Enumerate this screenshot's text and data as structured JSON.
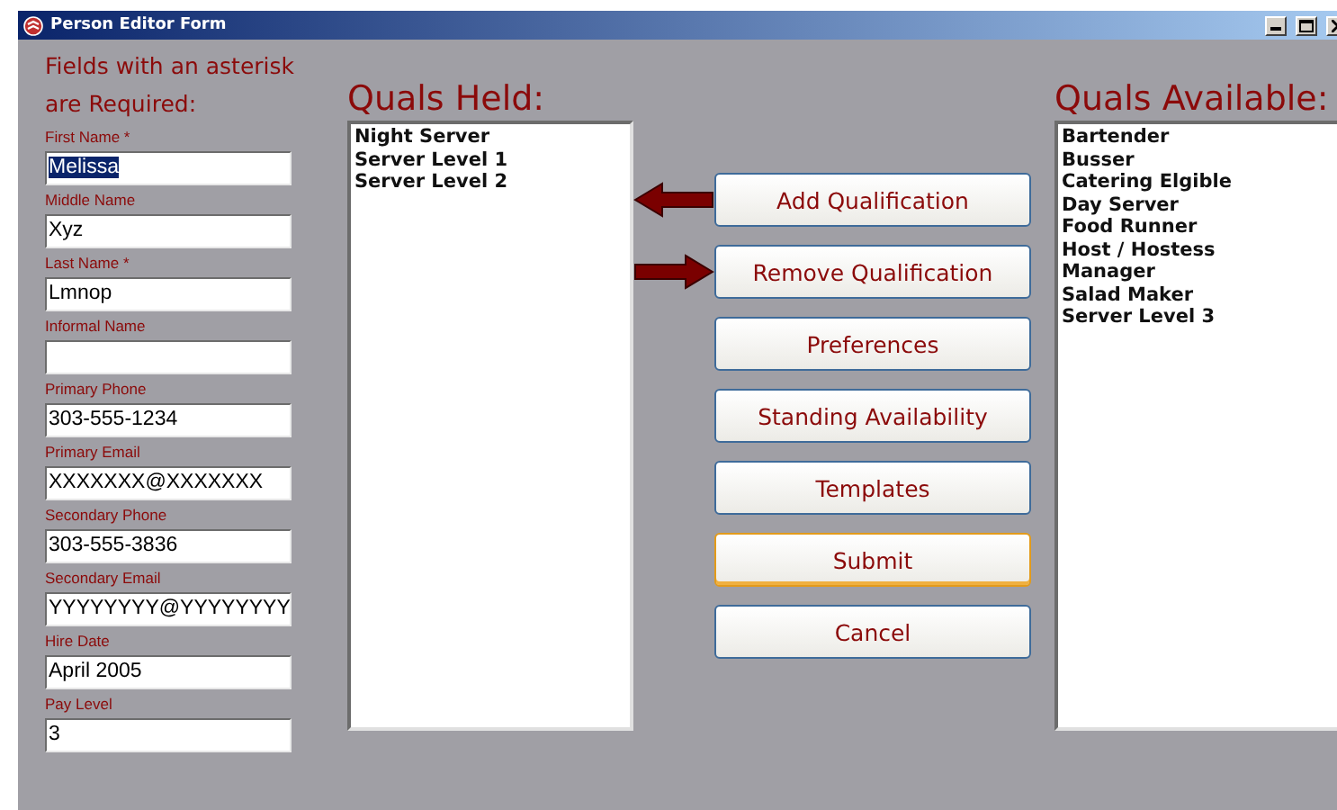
{
  "window": {
    "title": "Person Editor Form"
  },
  "required_note": "Fields with an asterisk are Required:",
  "fields": [
    {
      "label": "First Name *",
      "value": "Melissa",
      "selected": true
    },
    {
      "label": "Middle Name",
      "value": "Xyz",
      "selected": false
    },
    {
      "label": "Last Name *",
      "value": "Lmnop",
      "selected": false
    },
    {
      "label": "Informal Name"
    },
    {
      "label": "Primary Phone",
      "value": "303-555-1234",
      "selected": false
    },
    {
      "label": "Primary Email",
      "value": "XXXXXXX@XXXXXXX",
      "selected": false
    },
    {
      "label": "Secondary Phone",
      "value": "303-555-3836",
      "selected": false
    },
    {
      "label": "Secondary Email",
      "value": "YYYYYYYY@YYYYYYYY",
      "selected": false
    },
    {
      "label": "Hire Date",
      "value": "April 2005",
      "selected": false
    },
    {
      "label": "Pay Level",
      "value": "3",
      "selected": false
    }
  ],
  "quals_held": {
    "title": "Quals Held:",
    "items": [
      "Night Server",
      "Server Level 1",
      "Server Level 2"
    ]
  },
  "buttons": [
    {
      "label": "Add Qualification",
      "kind": "moveleft",
      "default": false
    },
    {
      "label": "Remove Qualification",
      "kind": "moveright",
      "default": false
    },
    {
      "label": "Preferences",
      "kind": "plain",
      "default": false
    },
    {
      "label": "Standing Availability",
      "kind": "plain",
      "default": false
    },
    {
      "label": "Templates",
      "kind": "plain",
      "default": false
    },
    {
      "label": "Submit",
      "kind": "plain",
      "default": true
    },
    {
      "label": "Cancel",
      "kind": "plain",
      "default": false
    }
  ],
  "quals_available": {
    "title": "Quals Available:",
    "items": [
      "Bartender",
      "Busser",
      "Catering Elgible",
      "Day Server",
      "Food Runner",
      "Host / Hostess",
      "Manager",
      "Salad Maker",
      "Server Level 3"
    ]
  }
}
